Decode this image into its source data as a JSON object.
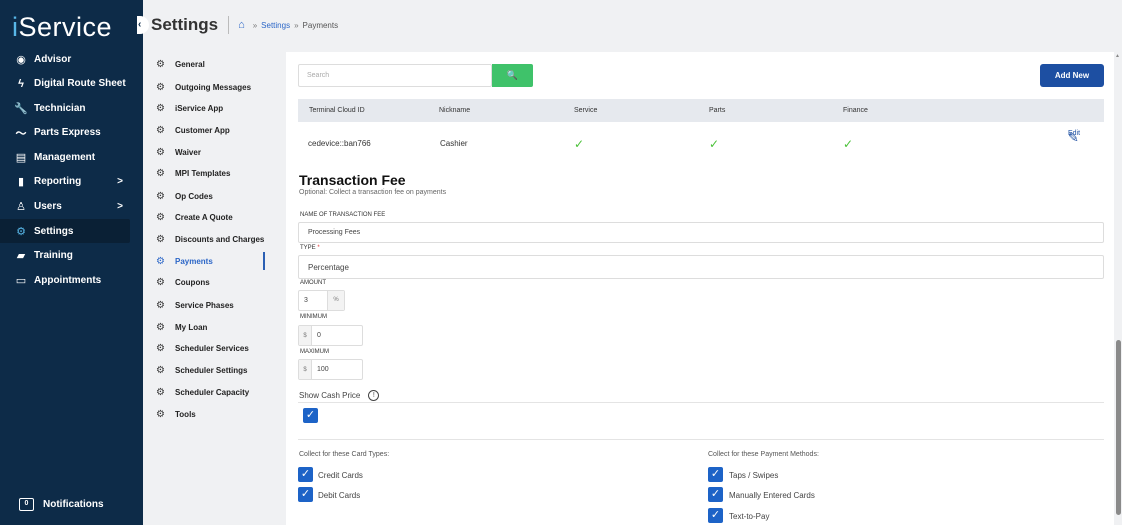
{
  "app": {
    "brand_i": "i",
    "brand_rest": "Service",
    "collapse_glyph": "‹"
  },
  "sidebar": {
    "items": [
      {
        "label": "Advisor",
        "icon": "eye-icon",
        "glyph": "◉"
      },
      {
        "label": "Digital Route Sheet",
        "icon": "bolt-icon",
        "glyph": "ϟ"
      },
      {
        "label": "Technician",
        "icon": "wrench-icon",
        "glyph": "🔧"
      },
      {
        "label": "Parts Express",
        "icon": "trend-icon",
        "glyph": "〜"
      },
      {
        "label": "Management",
        "icon": "document-icon",
        "glyph": "▤"
      },
      {
        "label": "Reporting",
        "icon": "bar-chart-icon",
        "glyph": "▮",
        "arrow": ">"
      },
      {
        "label": "Users",
        "icon": "user-icon",
        "glyph": "♙",
        "arrow": ">"
      },
      {
        "label": "Settings",
        "icon": "gear-icon",
        "glyph": "⚙"
      },
      {
        "label": "Training",
        "icon": "book-icon",
        "glyph": "▰"
      },
      {
        "label": "Appointments",
        "icon": "calendar-icon",
        "glyph": "▭"
      }
    ],
    "notifications": {
      "label": "Notifications",
      "icon_glyph": "0"
    }
  },
  "header": {
    "title": "Settings",
    "breadcrumb_sep": "»",
    "breadcrumb_link": "Settings",
    "breadcrumb_current": "Payments",
    "home_glyph": "⌂"
  },
  "submenu": {
    "gear_glyph": "⚙",
    "items": [
      "General",
      "Outgoing Messages",
      "iService App",
      "Customer App",
      "Waiver",
      "MPI Templates",
      "Op Codes",
      "Create A Quote",
      "Discounts and Charges",
      "Payments",
      "Coupons",
      "Service Phases",
      "My Loan",
      "Scheduler Services",
      "Scheduler Settings",
      "Scheduler Capacity",
      "Tools"
    ],
    "active": "Payments"
  },
  "toolbar": {
    "search_placeholder": "Search",
    "search_glyph": "🔍",
    "add_new_label": "Add New"
  },
  "table": {
    "headers": [
      "Terminal Cloud ID",
      "Nickname",
      "Service",
      "Parts",
      "Finance"
    ],
    "rows": [
      {
        "terminal_id": "cedevice::ban766",
        "nickname": "Cashier",
        "service": "✓",
        "parts": "✓",
        "finance": "✓",
        "edit_label": "Edit",
        "edit_glyph": "✎"
      }
    ]
  },
  "transaction_fee": {
    "title": "Transaction Fee",
    "subtitle": "Optional: Collect a transaction fee on payments",
    "name_label": "NAME OF TRANSACTION FEE",
    "name_value": "Processing Fees",
    "type_label": "TYPE",
    "required_mark": "*",
    "type_value": "Percentage",
    "amount_label": "AMOUNT",
    "amount_value": "3",
    "amount_suffix": "%",
    "minimum_label": "MINIMUM",
    "minimum_value": "0",
    "maximum_label": "MAXIMUM",
    "maximum_value": "100",
    "currency_prefix": "$",
    "show_cash_label": "Show Cash Price",
    "info_glyph": "!",
    "check_glyph": "✓"
  },
  "card_types": {
    "title": "Collect for these Card Types:",
    "items": [
      "Credit Cards",
      "Debit Cards"
    ]
  },
  "payment_methods": {
    "title": "Collect for these Payment Methods:",
    "items": [
      "Taps / Swipes",
      "Manually Entered Cards",
      "Text-to-Pay"
    ]
  },
  "colors": {
    "sidebar": "#0d2b48",
    "accent": "#1d4fa2",
    "search_button": "#3fc26a",
    "check": "#4cc23a",
    "checkbox": "#1d63c7"
  }
}
